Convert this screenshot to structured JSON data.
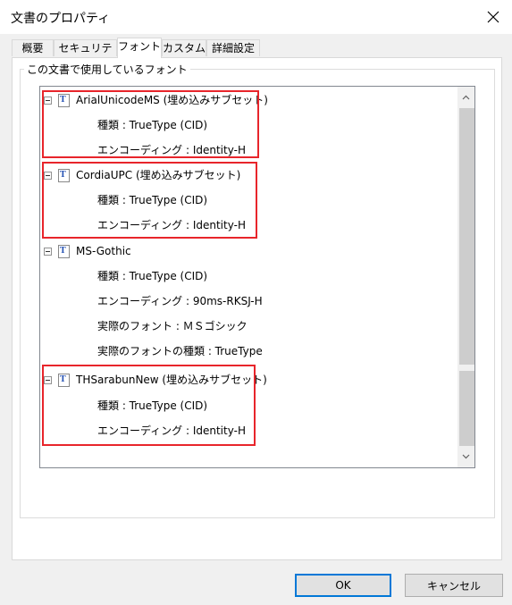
{
  "window": {
    "title": "文書のプロパティ"
  },
  "tabs": [
    {
      "label": "概要",
      "active": false
    },
    {
      "label": "セキュリティ",
      "active": false
    },
    {
      "label": "フォント",
      "active": true
    },
    {
      "label": "カスタム",
      "active": false
    },
    {
      "label": "詳細設定",
      "active": false
    }
  ],
  "fonts_group": {
    "label": "この文書で使用しているフォント"
  },
  "fonts": [
    {
      "name": "ArialUnicodeMS (埋め込みサブセット)",
      "props": [
        "種類 : TrueType (CID)",
        "エンコーディング : Identity-H"
      ],
      "highlighted": true
    },
    {
      "name": "CordiaUPC (埋め込みサブセット)",
      "props": [
        "種類 : TrueType (CID)",
        "エンコーディング : Identity-H"
      ],
      "highlighted": true
    },
    {
      "name": "MS-Gothic",
      "props": [
        "種類 : TrueType (CID)",
        "エンコーディング : 90ms-RKSJ-H",
        "実際のフォント : ＭＳゴシック",
        "実際のフォントの種類 : TrueType"
      ],
      "highlighted": false
    },
    {
      "name": "THSarabunNew (埋め込みサブセット)",
      "props": [
        "種類 : TrueType (CID)",
        "エンコーディング : Identity-H"
      ],
      "highlighted": true
    }
  ],
  "highlight_color": "#e8252b",
  "buttons": {
    "ok": "OK",
    "cancel": "キャンセル"
  }
}
